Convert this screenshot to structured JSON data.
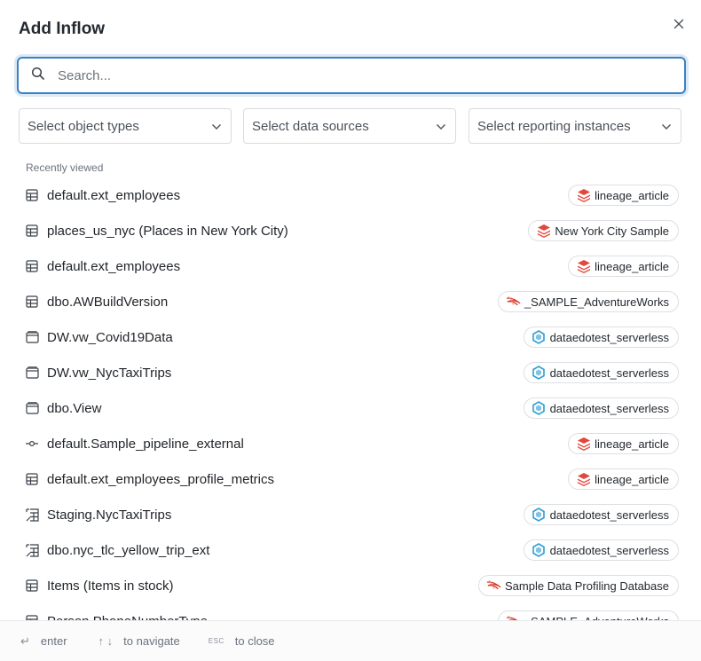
{
  "dialog": {
    "title": "Add Inflow"
  },
  "search": {
    "placeholder": "Search..."
  },
  "filters": [
    {
      "label": "Select object types"
    },
    {
      "label": "Select data sources"
    },
    {
      "label": "Select reporting instances"
    }
  ],
  "recent": {
    "label": "Recently viewed",
    "items": [
      {
        "name": "default.ext_employees",
        "icon": "table-icon",
        "source": "lineage_article",
        "source_icon": "databricks-icon"
      },
      {
        "name": "places_us_nyc (Places in New York City)",
        "icon": "table-icon",
        "source": "New York City Sample",
        "source_icon": "databricks-icon"
      },
      {
        "name": "default.ext_employees",
        "icon": "table-icon",
        "source": "lineage_article",
        "source_icon": "databricks-icon"
      },
      {
        "name": "dbo.AWBuildVersion",
        "icon": "table-icon",
        "source": "_SAMPLE_AdventureWorks",
        "source_icon": "sql-server-icon"
      },
      {
        "name": "DW.vw_Covid19Data",
        "icon": "view-icon",
        "source": "dataedotest_serverless",
        "source_icon": "synapse-icon"
      },
      {
        "name": "DW.vw_NycTaxiTrips",
        "icon": "view-icon",
        "source": "dataedotest_serverless",
        "source_icon": "synapse-icon"
      },
      {
        "name": "dbo.View",
        "icon": "view-icon",
        "source": "dataedotest_serverless",
        "source_icon": "synapse-icon"
      },
      {
        "name": "default.Sample_pipeline_external",
        "icon": "pipeline-icon",
        "source": "lineage_article",
        "source_icon": "databricks-icon"
      },
      {
        "name": "default.ext_employees_profile_metrics",
        "icon": "table-icon",
        "source": "lineage_article",
        "source_icon": "databricks-icon"
      },
      {
        "name": "Staging.NycTaxiTrips",
        "icon": "external-table-icon",
        "source": "dataedotest_serverless",
        "source_icon": "synapse-icon"
      },
      {
        "name": "dbo.nyc_tlc_yellow_trip_ext",
        "icon": "external-table-icon",
        "source": "dataedotest_serverless",
        "source_icon": "synapse-icon"
      },
      {
        "name": "Items (Items in stock)",
        "icon": "table-icon",
        "source": "Sample Data Profiling Database",
        "source_icon": "sql-server-icon"
      },
      {
        "name": "Person.PhoneNumberType",
        "icon": "table-icon",
        "source": "_SAMPLE_AdventureWorks",
        "source_icon": "sql-server-icon"
      }
    ]
  },
  "footer": {
    "enter_key": "↵",
    "enter_label": "enter",
    "nav_keys": "↑ ↓",
    "nav_label": "to navigate",
    "esc_key": "ESC",
    "esc_label": "to close"
  },
  "colors": {
    "accent": "#3b82c4",
    "databricks": "#e2483d",
    "synapse": "#2f9ed2",
    "sqlserver": "#d83b2a"
  }
}
